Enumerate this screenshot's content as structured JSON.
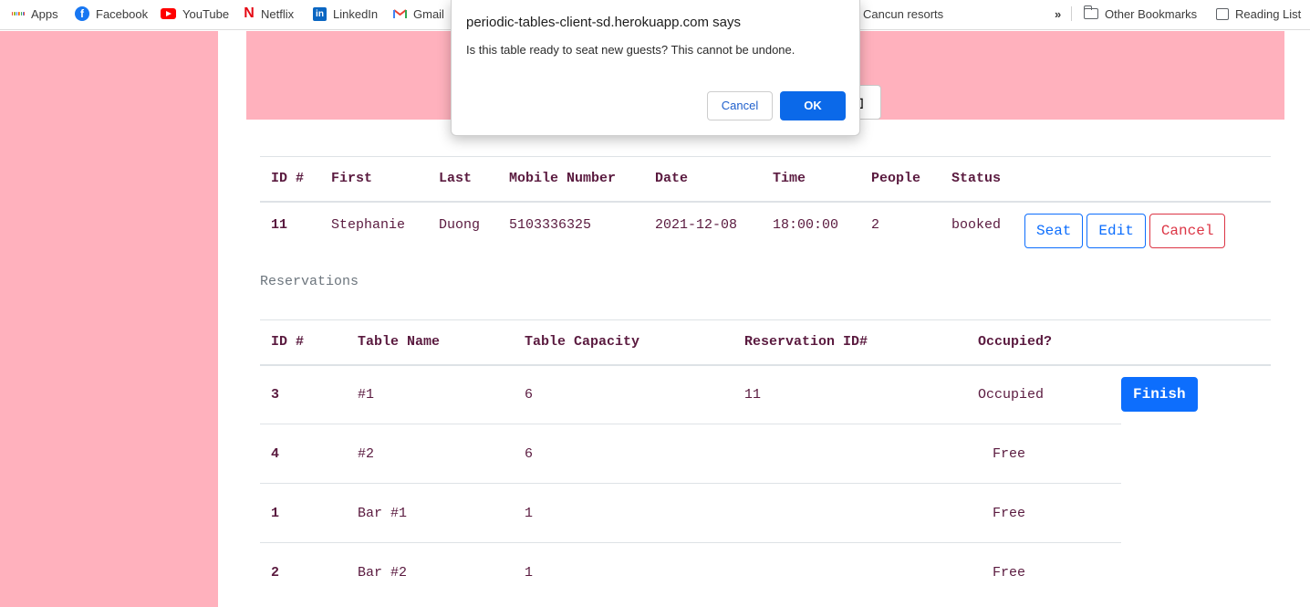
{
  "bookmarks": {
    "items": [
      {
        "label": "Apps",
        "icon": "apps-grid-icon"
      },
      {
        "label": "Facebook",
        "icon": "facebook-icon"
      },
      {
        "label": "YouTube",
        "icon": "youtube-icon"
      },
      {
        "label": "Netflix",
        "icon": "netflix-icon"
      },
      {
        "label": "LinkedIn",
        "icon": "linkedin-icon"
      },
      {
        "label": "Gmail",
        "icon": "gmail-icon"
      },
      {
        "label": "Cancun resorts"
      }
    ],
    "overflow": "»",
    "other_bookmarks": "Other Bookmarks",
    "reading_list": "Reading List"
  },
  "dialog": {
    "title": "periodic-tables-client-sd.herokuapp.com says",
    "message": "Is this table ready to seat new guests? This cannot be undone.",
    "cancel_label": "Cancel",
    "ok_label": "OK"
  },
  "header": {
    "hidden_button_glyph": "▯"
  },
  "reservations_table": {
    "columns": [
      "ID #",
      "First",
      "Last",
      "Mobile Number",
      "Date",
      "Time",
      "People",
      "Status"
    ],
    "rows": [
      {
        "id": "11",
        "first": "Stephanie",
        "last": "Duong",
        "mobile": "5103336325",
        "date": "2021-12-08",
        "time": "18:00:00",
        "people": "2",
        "status": "booked",
        "actions": {
          "seat": "Seat",
          "edit": "Edit",
          "cancel": "Cancel"
        }
      }
    ]
  },
  "section_title": "Reservations",
  "tables_table": {
    "columns": [
      "ID #",
      "Table Name",
      "Table Capacity",
      "Reservation ID#",
      "Occupied?"
    ],
    "rows": [
      {
        "id": "3",
        "name": "#1",
        "capacity": "6",
        "reservation_id": "11",
        "occupied": "Occupied",
        "action": "Finish"
      },
      {
        "id": "4",
        "name": "#2",
        "capacity": "6",
        "reservation_id": "",
        "occupied": "Free"
      },
      {
        "id": "1",
        "name": "Bar #1",
        "capacity": "1",
        "reservation_id": "",
        "occupied": "Free"
      },
      {
        "id": "2",
        "name": "Bar #2",
        "capacity": "1",
        "reservation_id": "",
        "occupied": "Free"
      }
    ]
  },
  "colors": {
    "sidebar_pink": "#ffb1bd",
    "text_maroon": "#5a1a3f",
    "primary": "#0d6efd",
    "danger": "#dc3545"
  }
}
